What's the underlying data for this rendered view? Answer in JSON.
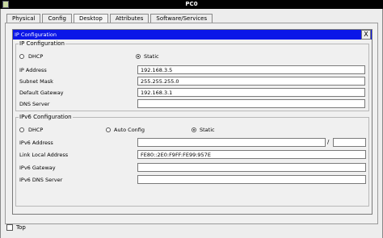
{
  "window": {
    "title": "PC0"
  },
  "tabs": [
    {
      "label": "Physical"
    },
    {
      "label": "Config"
    },
    {
      "label": "Desktop"
    },
    {
      "label": "Attributes"
    },
    {
      "label": "Software/Services"
    }
  ],
  "active_tab": "Desktop",
  "dialog": {
    "title": "IP Configuration",
    "close_label": "X"
  },
  "ipv4": {
    "legend": "IP Configuration",
    "dhcp_label": "DHCP",
    "static_label": "Static",
    "mode": "Static",
    "ip_label": "IP Address",
    "ip_value": "192.168.3.5",
    "mask_label": "Subnet Mask",
    "mask_value": "255.255.255.0",
    "gateway_label": "Default Gateway",
    "gateway_value": "192.168.3.1",
    "dns_label": "DNS Server",
    "dns_value": ""
  },
  "ipv6": {
    "legend": "IPv6 Configuration",
    "dhcp_label": "DHCP",
    "auto_label": "Auto Config",
    "static_label": "Static",
    "mode": "Static",
    "address_label": "IPv6 Address",
    "address_value": "",
    "slash": "/",
    "prefix_value": "",
    "link_local_label": "Link Local Address",
    "link_local_value": "FE80::2E0:F9FF:FE99:957E",
    "gateway_label": "IPv6 Gateway",
    "gateway_value": "",
    "dns_label": "IPv6 DNS Server",
    "dns_value": ""
  },
  "footer": {
    "top_label": "Top",
    "top_checked": false
  }
}
